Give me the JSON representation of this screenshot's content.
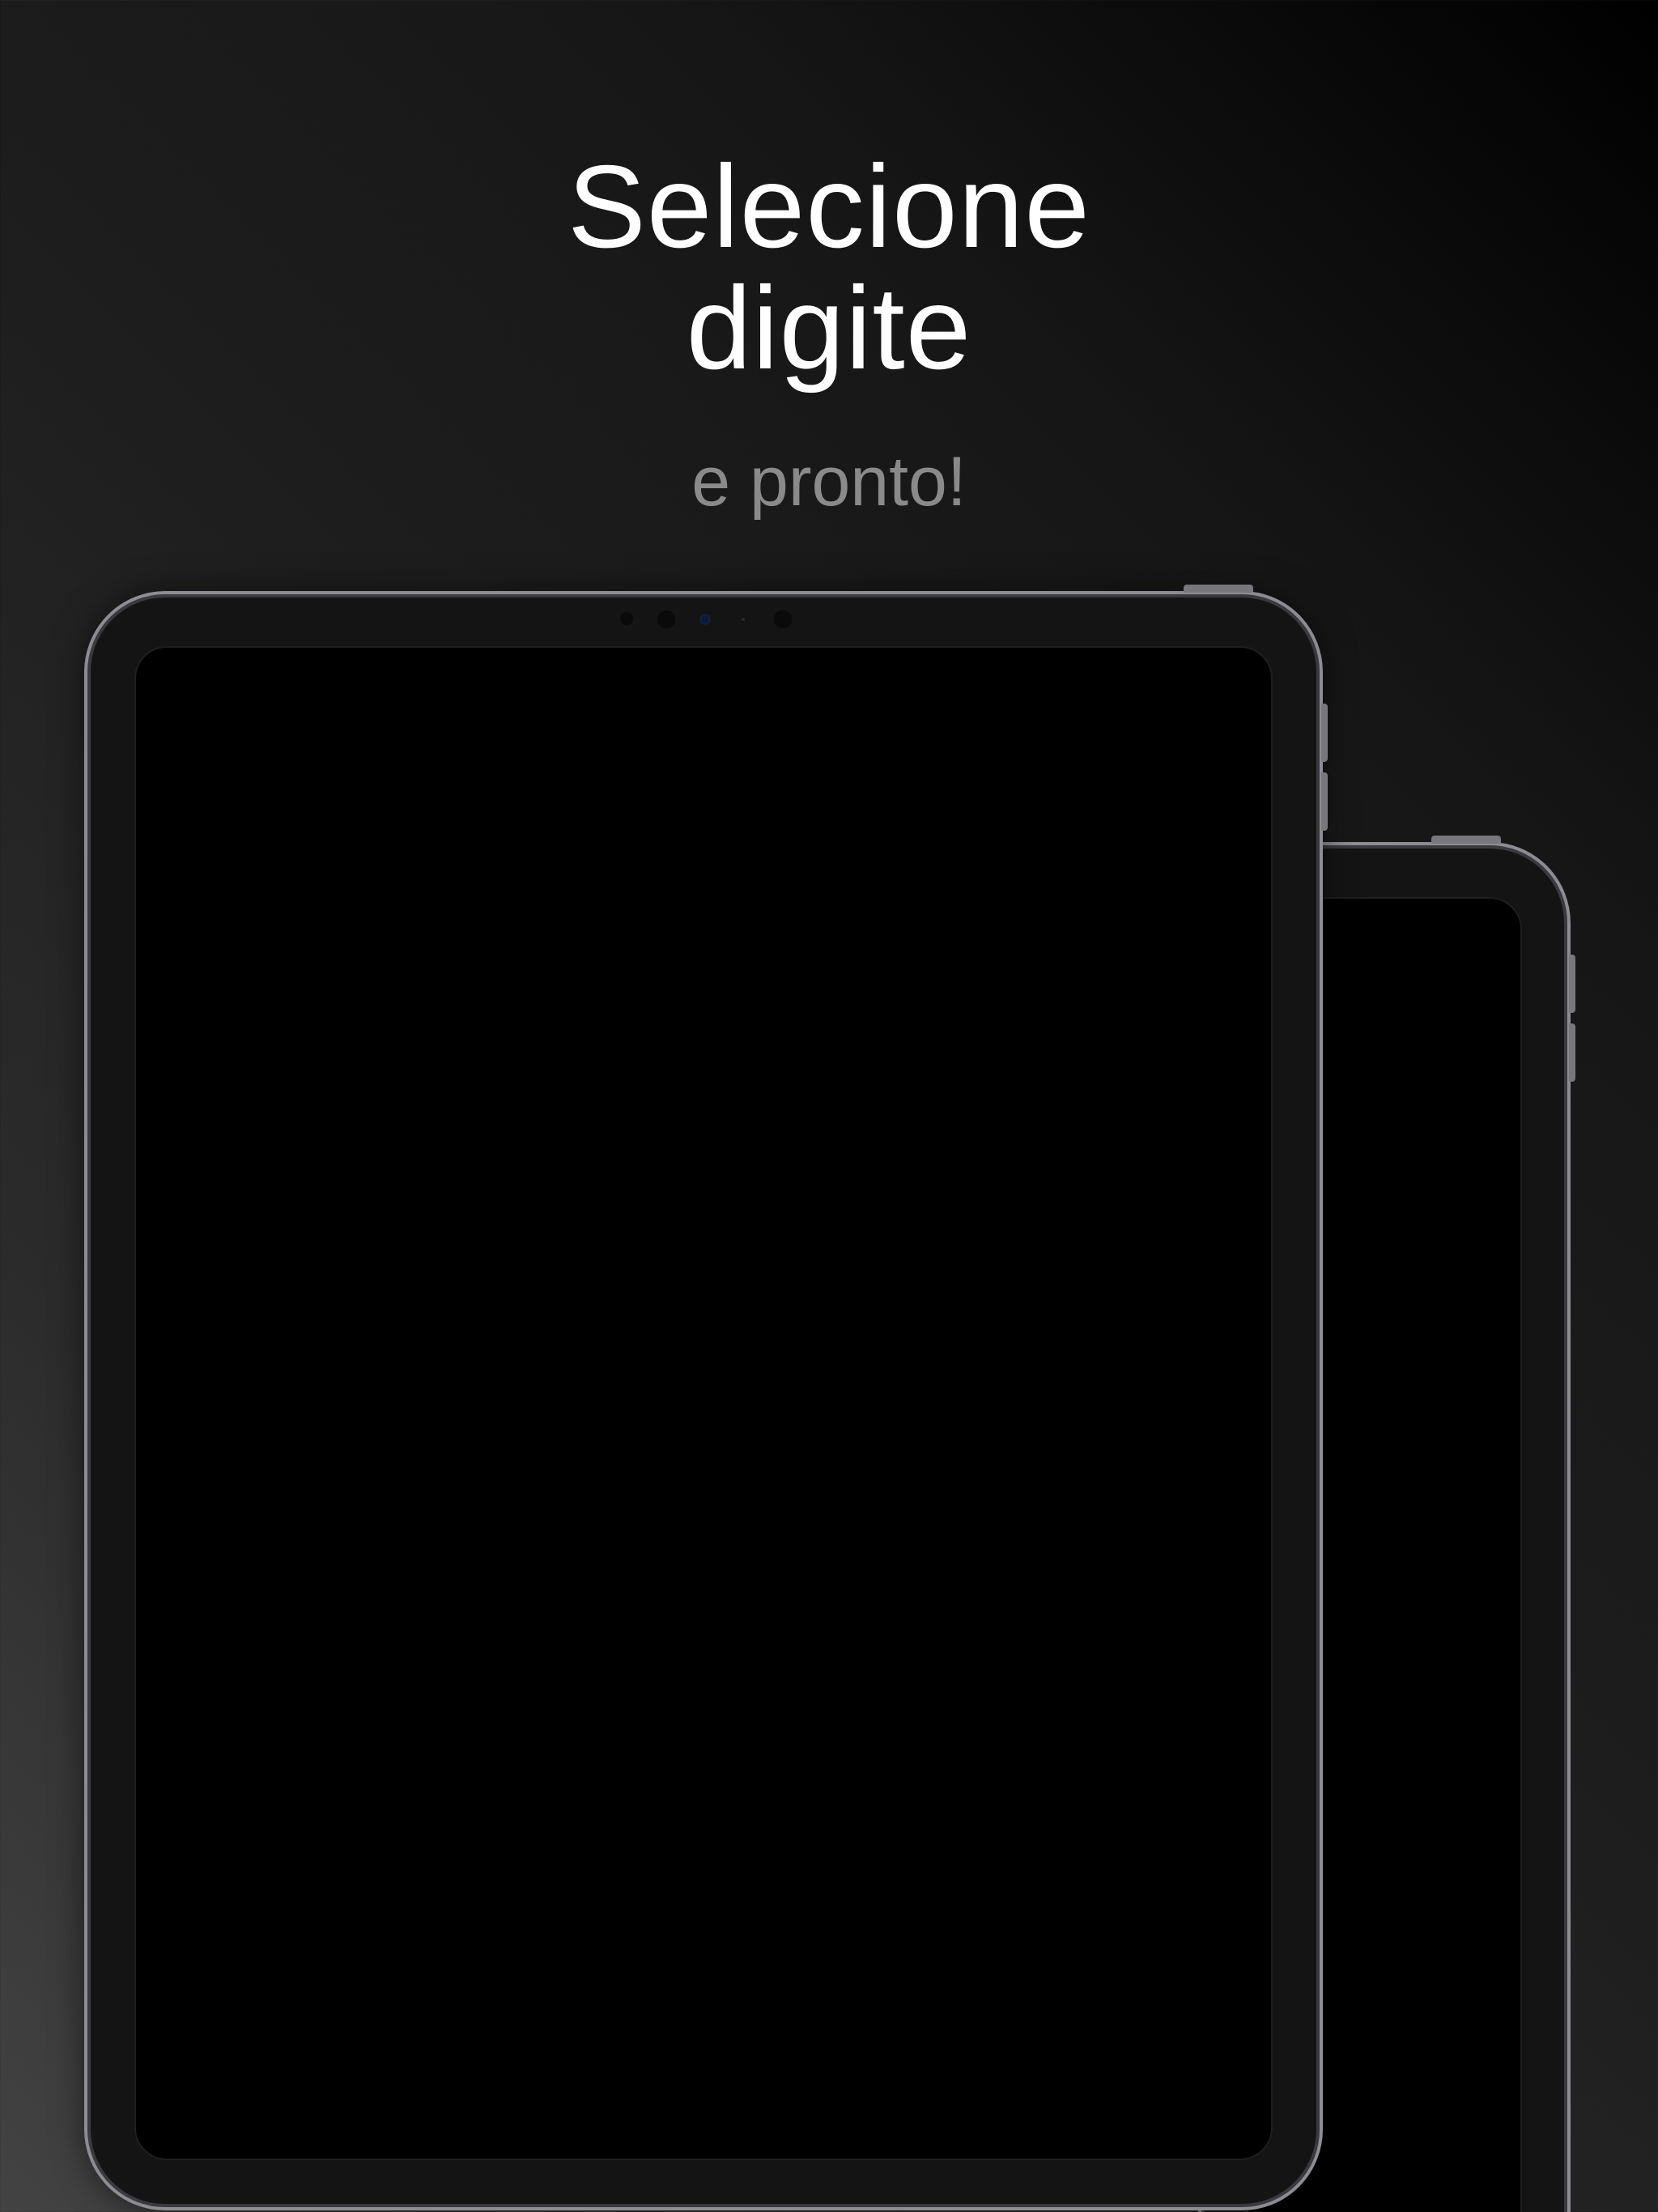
{
  "headline": {
    "line1": "Selecione",
    "line2": "digite"
  },
  "subtitle": "e pronto!",
  "colors": {
    "background_dark": "#000000",
    "background_light": "#434343",
    "headline": "#ffffff",
    "subtitle": "#8a8a8a",
    "device_frame": "#8c8c92",
    "device_bezel": "#141414",
    "screen": "#000000"
  },
  "devices": [
    {
      "name": "front-tablet"
    },
    {
      "name": "back-tablet"
    }
  ]
}
